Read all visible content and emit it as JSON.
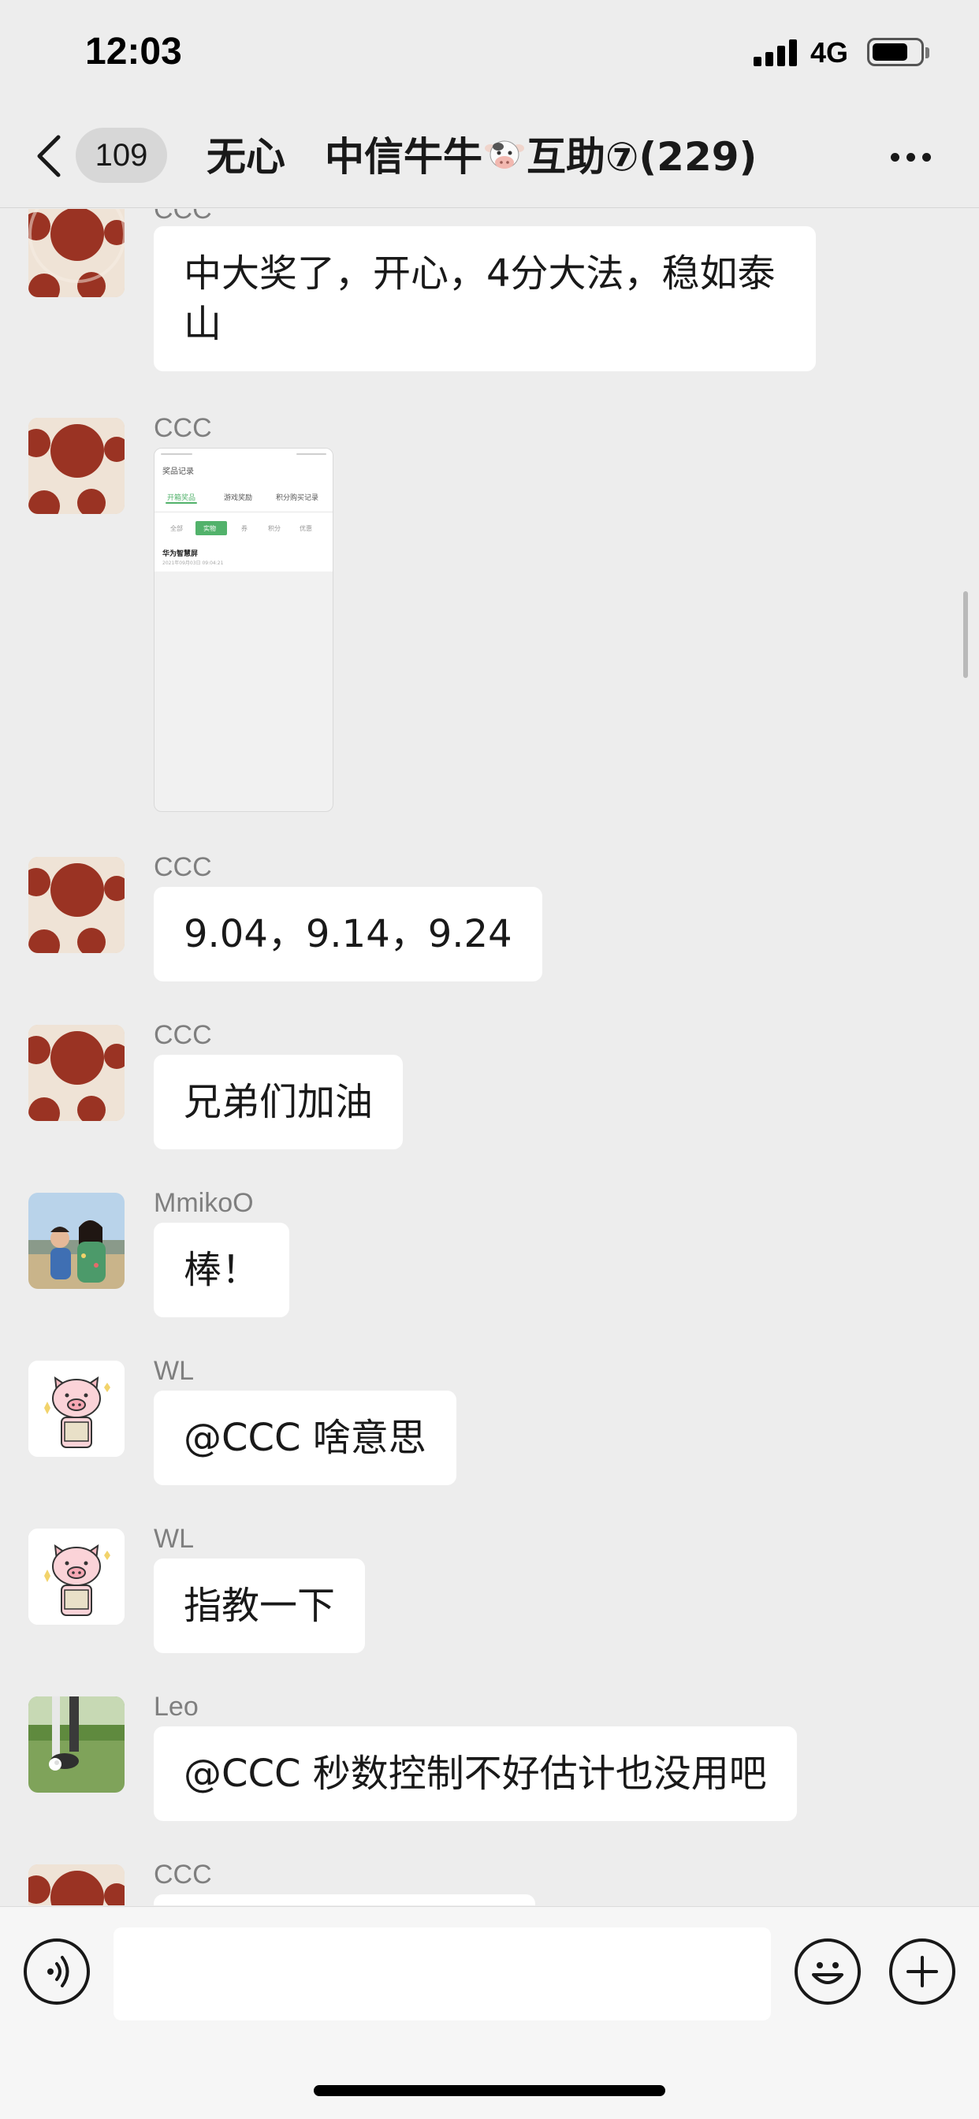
{
  "status_bar": {
    "time": "12:03",
    "network": "4G"
  },
  "nav": {
    "back_icon": "chevron-left-icon",
    "unread_count": "109",
    "title_prefix": "无心　中信牛牛",
    "title_emoji": "cow-face-emoji",
    "title_suffix": "互助⑦(229)",
    "more_icon": "ellipsis-icon"
  },
  "messages": [
    {
      "sender": "CCC",
      "avatar": "red-dots-avatar",
      "text": "中大奖了，开心，4分大法，稳如泰山"
    },
    {
      "sender": "CCC",
      "avatar": "red-dots-avatar",
      "image": "screenshot-thumbnail"
    },
    {
      "sender": "CCC",
      "avatar": "red-dots-avatar",
      "text": "9.04，9.14，9.24"
    },
    {
      "sender": "CCC",
      "avatar": "red-dots-avatar",
      "text": "兄弟们加油"
    },
    {
      "sender": "MmikoO",
      "avatar": "mother-child-photo-avatar",
      "text": "棒！"
    },
    {
      "sender": "WL",
      "avatar": "pig-sticker-avatar",
      "text": "@CCC 啥意思"
    },
    {
      "sender": "WL",
      "avatar": "pig-sticker-avatar",
      "text": "指教一下"
    },
    {
      "sender": "Leo",
      "avatar": "golf-photo-avatar",
      "text": "@CCC 秒数控制不好估计也没用吧"
    },
    {
      "sender": "CCC",
      "avatar": "red-dots-avatar",
      "text": ""
    }
  ],
  "thumbnail": {
    "title": "奖品记录",
    "tabs": [
      "开箱奖品",
      "游戏奖励",
      "积分购买记录"
    ],
    "filters": [
      "全部",
      "实物",
      "券",
      "积分",
      "优惠"
    ],
    "item_title": "华为智慧屏",
    "item_date": "2021年09月03日 09:04:21"
  },
  "input_bar": {
    "voice_icon": "voice-icon",
    "message_placeholder": "",
    "emoji_icon": "smiley-icon",
    "plus_icon": "plus-icon"
  }
}
